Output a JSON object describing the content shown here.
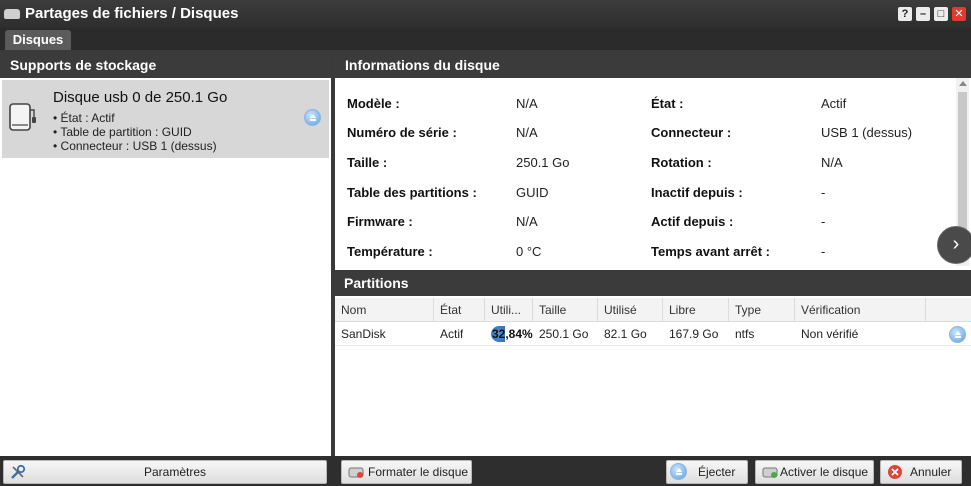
{
  "window": {
    "title": "Partages de fichiers / Disques",
    "help_label": "?",
    "minimize_label": "–",
    "maximize_label": "□",
    "close_label": "✕"
  },
  "tabs": [
    {
      "label": "Disques",
      "active": true
    }
  ],
  "left_panel": {
    "title": "Supports de stockage",
    "disk": {
      "name": "Disque usb 0 de 250.1 Go",
      "lines": [
        "• État : Actif",
        "• Table de partition : GUID",
        "• Connecteur : USB 1 (dessus)"
      ]
    },
    "parameters_label": "Paramètres"
  },
  "info": {
    "title": "Informations du disque",
    "left": [
      {
        "label": "Modèle :",
        "value": "N/A"
      },
      {
        "label": "Numéro de série :",
        "value": "N/A"
      },
      {
        "label": "Taille :",
        "value": "250.1 Go"
      },
      {
        "label": "Table des partitions :",
        "value": "GUID"
      },
      {
        "label": "Firmware :",
        "value": "N/A"
      },
      {
        "label": "Température :",
        "value": "0 °C"
      }
    ],
    "right": [
      {
        "label": "État :",
        "value": "Actif"
      },
      {
        "label": "Connecteur :",
        "value": "USB 1 (dessus)"
      },
      {
        "label": "Rotation :",
        "value": "N/A"
      },
      {
        "label": "Inactif depuis :",
        "value": "-"
      },
      {
        "label": "Actif depuis :",
        "value": "-"
      },
      {
        "label": "Temps avant arrêt :",
        "value": "-"
      }
    ]
  },
  "partitions": {
    "title": "Partitions",
    "columns": [
      "Nom",
      "État",
      "Utili...",
      "Taille",
      "Utilisé",
      "Libre",
      "Type",
      "Vérification"
    ],
    "rows": [
      {
        "nom": "SanDisk",
        "etat": "Actif",
        "utilisation": "32,84%",
        "utilisation_fraction": 0.3284,
        "taille": "250.1 Go",
        "utilise": "82.1 Go",
        "libre": "167.9 Go",
        "type": "ntfs",
        "verification": "Non vérifié"
      }
    ]
  },
  "actions": {
    "format_label": "Formater le disque",
    "eject_label": "Éjecter",
    "activate_label": "Activer le disque",
    "cancel_label": "Annuler"
  },
  "colors": {
    "header_bg": "#3b3b3b",
    "selected_item_bg": "#d7d7d7",
    "close_red": "#e23b2e",
    "eject_blue": "#5aa0df"
  }
}
